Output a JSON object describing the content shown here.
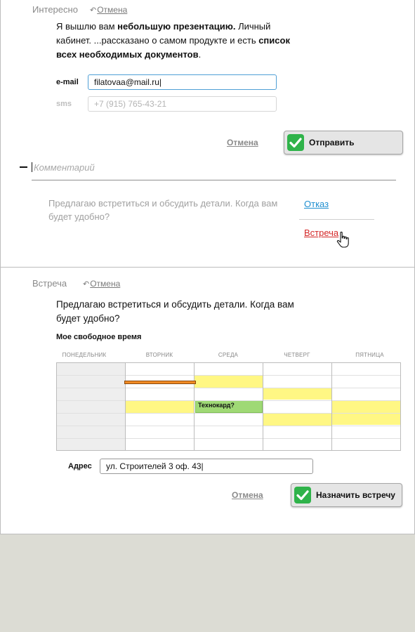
{
  "section1": {
    "title": "Интересно",
    "undo_label": "Отмена",
    "message": {
      "p1": "Я вышлю вам ",
      "b1": "небольшую презентацию.",
      "p2": " Личный кабинет. ...рассказано о самом продукте и есть ",
      "b2": "список всех необходимых документов",
      "p3": "."
    },
    "email": {
      "label": "e-mail",
      "value": "filatovaa@mail.ru|"
    },
    "sms": {
      "label": "sms",
      "placeholder": "+7 (915) 765-43-21"
    },
    "cancel_label": "Отмена",
    "send_label": "Отправить"
  },
  "comment": {
    "placeholder": "Комментарий"
  },
  "proposal": {
    "text": "Предлагаю встретиться и обсудить детали. Когда вам будет удобно?",
    "refuse_label": "Отказ",
    "meet_label": "Встреча"
  },
  "section2": {
    "title": "Встреча",
    "undo_label": "Отмена",
    "message": "Предлагаю встретиться и обсудить детали. Когда вам будет удобно?",
    "schedule": {
      "title": "Мое свободное время",
      "days": [
        "ПОНЕДЕЛЬНИК",
        "ВТОРНИК",
        "СРЕДА",
        "ЧЕТВЕРГ",
        "ПЯТНИЦА"
      ],
      "busy_label": "Технокард?"
    },
    "address": {
      "label": "Адрес",
      "value": "ул. Строителей 3 оф. 43|"
    },
    "cancel_label": "Отмена",
    "submit_label": "Назначить встречу"
  },
  "colors": {
    "accent_green": "#2fb34a",
    "link_blue": "#1f8fd0",
    "link_red": "#d42828",
    "free_slot": "#fff784",
    "busy_slot": "#9fd975",
    "drag_bar": "#f08a24"
  },
  "icons": {
    "undo": "undo-arrow-icon",
    "check": "check-icon",
    "cursor": "hand-pointer-icon"
  }
}
